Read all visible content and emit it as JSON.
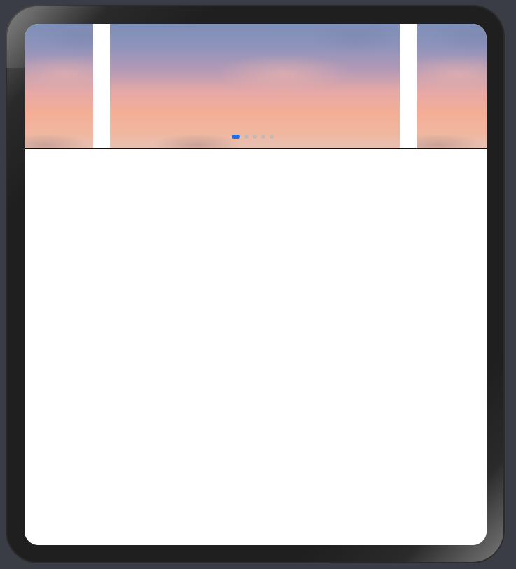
{
  "device": {
    "bezel_color": "#1f1f1f",
    "screen_bg": "#ffffff"
  },
  "carousel": {
    "slide_count": 5,
    "active_index": 0,
    "indicator_active_color": "#1e6fe6",
    "indicator_inactive_color": "#b8b7bd",
    "slides": [
      {
        "image": "sunset-sky-photo"
      },
      {
        "image": "sunset-sky-photo"
      },
      {
        "image": "sunset-sky-photo"
      }
    ]
  }
}
